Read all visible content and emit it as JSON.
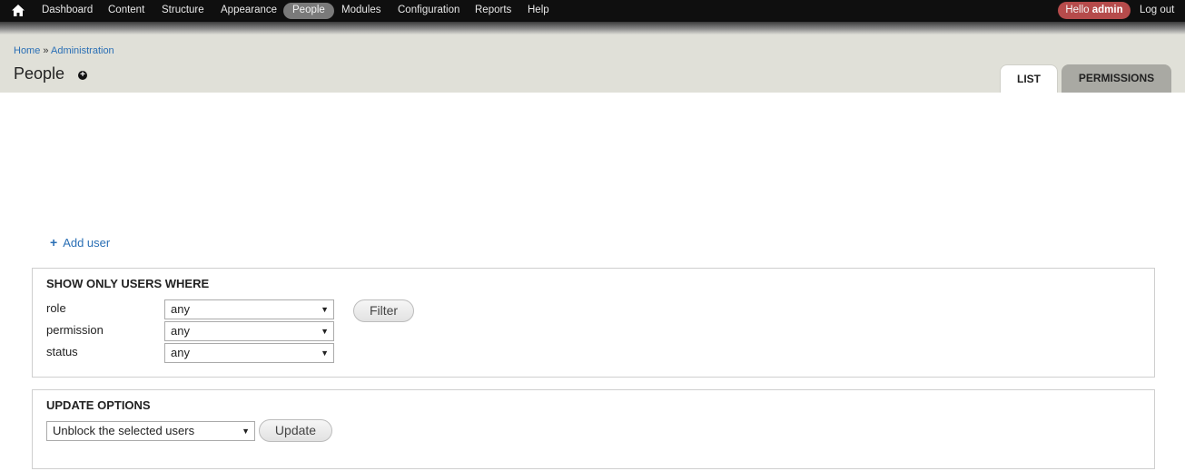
{
  "toolbar": {
    "home_icon": "home-icon",
    "items": [
      {
        "label": "Dashboard"
      },
      {
        "label": "Content"
      },
      {
        "label": "Structure"
      },
      {
        "label": "Appearance"
      },
      {
        "label": "People"
      },
      {
        "label": "Modules"
      },
      {
        "label": "Configuration"
      },
      {
        "label": "Reports"
      },
      {
        "label": "Help"
      }
    ],
    "hello_prefix": "Hello",
    "user": "admin",
    "logout": "Log out"
  },
  "breadcrumb": {
    "home": "Home",
    "separator": "»",
    "administration": "Administration"
  },
  "page_title": "People",
  "tabs": [
    {
      "label": "LIST"
    },
    {
      "label": "PERMISSIONS"
    }
  ],
  "add_user": {
    "icon": "plus-icon",
    "label": "Add user"
  },
  "filter": {
    "legend": "SHOW ONLY USERS WHERE",
    "fields": [
      {
        "label": "role",
        "value": "any"
      },
      {
        "label": "permission",
        "value": "any"
      },
      {
        "label": "status",
        "value": "any"
      }
    ],
    "button": "Filter"
  },
  "update": {
    "legend": "UPDATE OPTIONS",
    "value": "Unblock the selected users",
    "button": "Update"
  },
  "colors": {
    "toolbar": "#0f0f0f",
    "active_tab": "#7a7a7a",
    "hello_badge": "#b64b4b",
    "header": "#e0e0d8",
    "link": "#2a6fb5"
  }
}
